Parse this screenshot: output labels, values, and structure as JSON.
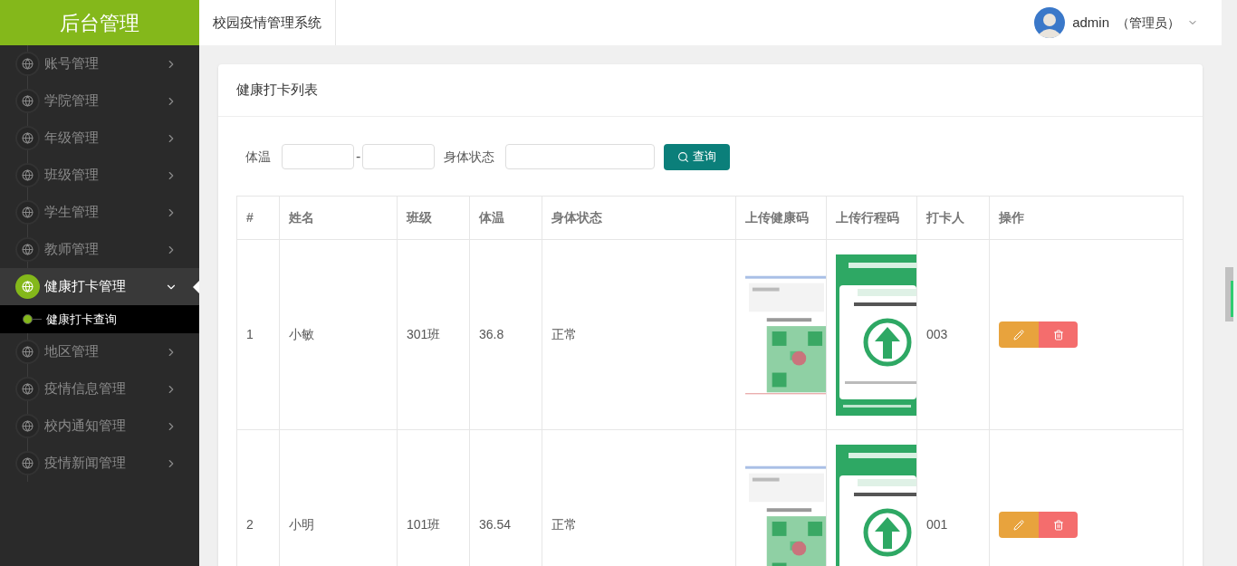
{
  "header": {
    "logo": "后台管理",
    "system_title": "校园疫情管理系统",
    "user_name": "admin",
    "user_role": "（管理员）"
  },
  "sidebar": {
    "items": [
      {
        "label": "账号管理",
        "selected": false,
        "expanded": false
      },
      {
        "label": "学院管理",
        "selected": false,
        "expanded": false
      },
      {
        "label": "年级管理",
        "selected": false,
        "expanded": false
      },
      {
        "label": "班级管理",
        "selected": false,
        "expanded": false
      },
      {
        "label": "学生管理",
        "selected": false,
        "expanded": false
      },
      {
        "label": "教师管理",
        "selected": false,
        "expanded": false
      },
      {
        "label": "健康打卡管理",
        "selected": true,
        "expanded": true,
        "children": [
          {
            "label": "健康打卡查询",
            "selected": true
          }
        ]
      },
      {
        "label": "地区管理",
        "selected": false,
        "expanded": false
      },
      {
        "label": "疫情信息管理",
        "selected": false,
        "expanded": false
      },
      {
        "label": "校内通知管理",
        "selected": false,
        "expanded": false
      },
      {
        "label": "疫情新闻管理",
        "selected": false,
        "expanded": false
      }
    ]
  },
  "card": {
    "title": "健康打卡列表",
    "filter": {
      "temperature_label": "体温",
      "separator": "-",
      "status_label": "身体状态",
      "search_button": "查询"
    },
    "table": {
      "columns": [
        "#",
        "姓名",
        "班级",
        "体温",
        "身体状态",
        "上传健康码",
        "上传行程码",
        "打卡人",
        "操作"
      ],
      "rows": [
        {
          "index": "1",
          "name": "小敏",
          "class": "301班",
          "temperature": "36.8",
          "status": "正常",
          "checker": "003"
        },
        {
          "index": "2",
          "name": "小明",
          "class": "101班",
          "temperature": "36.54",
          "status": "正常",
          "checker": "001"
        }
      ]
    }
  }
}
